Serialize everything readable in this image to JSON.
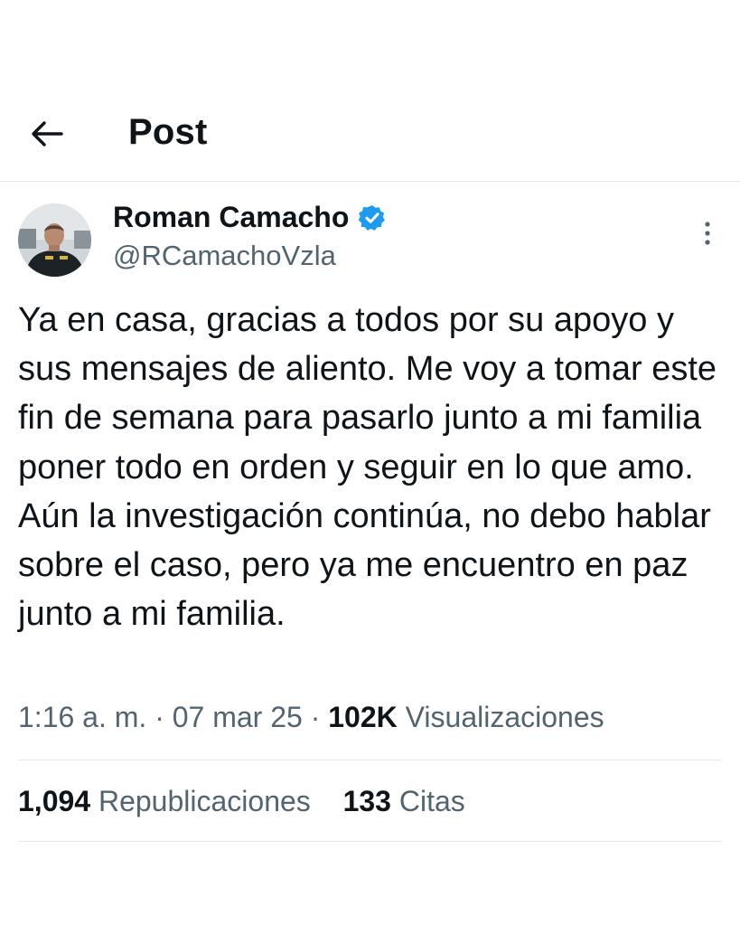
{
  "header": {
    "back_icon": "arrow-left-icon",
    "title": "Post"
  },
  "author": {
    "name": "Roman Camacho",
    "handle": "@RCamachoVzla",
    "verified": true,
    "verified_color": "#1d9bf0",
    "more_icon": "more-vertical-icon"
  },
  "post": {
    "text": "Ya en casa, gracias a todos por su apoyo y sus mensajes de aliento. Me voy a tomar este fin de semana para pasarlo junto a mi familia poner todo en orden y seguir en lo que amo. Aún la investigación continúa, no debo hablar sobre el caso, pero ya me encuentro en paz junto a mi familia."
  },
  "meta": {
    "time": "1:16 a. m.",
    "separator": "·",
    "date": "07 mar 25",
    "views_count": "102K",
    "views_label": "Visualizaciones"
  },
  "stats": {
    "reposts_count": "1,094",
    "reposts_label": "Republicaciones",
    "quotes_count": "133",
    "quotes_label": "Citas"
  },
  "colors": {
    "text_primary": "#0f1419",
    "text_secondary": "#536471",
    "divider": "#e6e9eb"
  }
}
